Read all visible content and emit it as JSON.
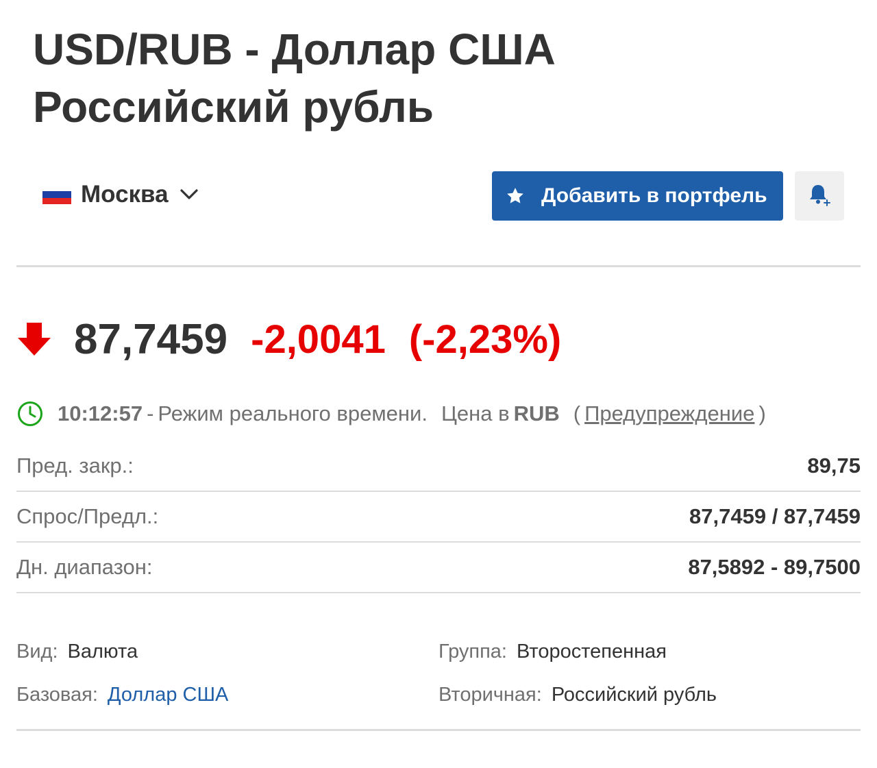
{
  "header": {
    "title_line1": "USD/RUB - Доллар США",
    "title_line2": "Российский рубль"
  },
  "market": {
    "label": "Москва",
    "flag_colors": [
      "#ffffff",
      "#1c3fa5",
      "#e52521"
    ]
  },
  "actions": {
    "add_to_portfolio": "Добавить в портфель",
    "alert_icon": "bell-plus-icon"
  },
  "quote": {
    "last": "87,7459",
    "change": "-2,0041",
    "change_pct": "(-2,23%)",
    "direction": "down",
    "down_color": "#e60000"
  },
  "status": {
    "time": "10:12:57",
    "separator": "-",
    "mode": "Режим реального времени.",
    "price_in": "Цена в",
    "currency": "RUB",
    "open_paren": "(",
    "warning_link": "Предупреждение",
    "close_paren": ")"
  },
  "stats": [
    {
      "label": "Пред. закр.:",
      "value": "89,75"
    },
    {
      "label": "Спрос/Предл.:",
      "value": "87,7459 / 87,7459"
    },
    {
      "label": "Дн. диапазон:",
      "value": "87,5892 - 89,7500"
    }
  ],
  "info": {
    "type_label": "Вид:",
    "type_value": "Валюта",
    "group_label": "Группа:",
    "group_value": "Второстепенная",
    "base_label": "Базовая:",
    "base_value": "Доллар США",
    "secondary_label": "Вторичная:",
    "secondary_value": "Российский рубль"
  },
  "colors": {
    "primary": "#1f5ea8",
    "text": "#333333",
    "muted": "#707070",
    "clock_green": "#1aa51a"
  }
}
